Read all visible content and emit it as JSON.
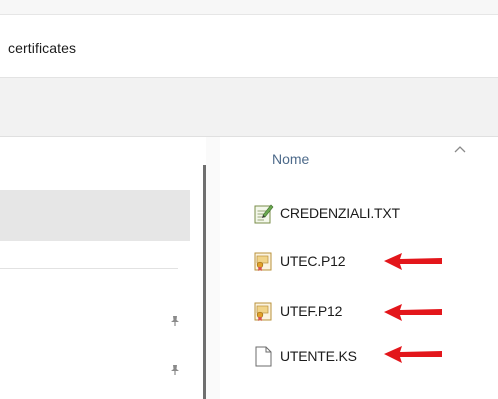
{
  "address": {
    "path": "certificates"
  },
  "file_list": {
    "column_header": "Nome",
    "files": [
      {
        "name": "CREDENZIALI.TXT",
        "icon": "text-file-icon",
        "highlighted": false
      },
      {
        "name": "UTEC.P12",
        "icon": "certificate-file-icon",
        "highlighted": true
      },
      {
        "name": "UTEF.P12",
        "icon": "certificate-file-icon",
        "highlighted": true
      },
      {
        "name": "UTENTE.KS",
        "icon": "blank-file-icon",
        "highlighted": true
      }
    ]
  },
  "colors": {
    "arrow": "#e3161b",
    "selected_nav": "#e6e6e6",
    "header_text": "#4d6a8a"
  }
}
